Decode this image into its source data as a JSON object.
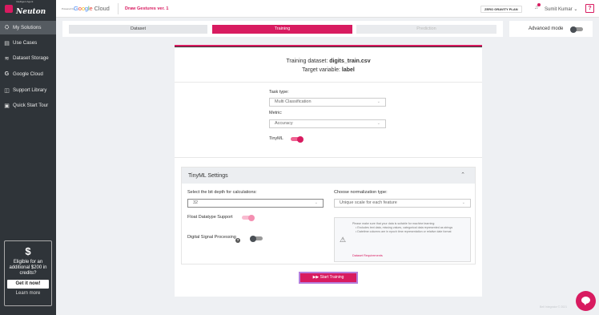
{
  "sidebar": {
    "logo_sub": "Intelligent Agent",
    "logo_name": "Neuton",
    "items": [
      {
        "label": "My Solutions",
        "icon": "gear-shield-icon",
        "active": true
      },
      {
        "label": "Use Cases",
        "icon": "briefcase-icon"
      },
      {
        "label": "Dataset Storage",
        "icon": "stack-icon"
      },
      {
        "label": "Google Cloud",
        "icon": "google-g-icon"
      },
      {
        "label": "Support Library",
        "icon": "book-icon"
      },
      {
        "label": "Quick Start Tour",
        "icon": "play-box-icon"
      }
    ],
    "credit": {
      "symbol": "$",
      "text": "Eligible for an additional $200 in credits?",
      "button": "Get it now!",
      "link": "Learn more"
    }
  },
  "topbar": {
    "powered_by": "Powered by",
    "cloud_name": "Google Cloud",
    "project": "Draw Gestures ver. 1",
    "plan": "ZERO GRAVITY PLAN",
    "user": "Sumit Kumar",
    "help": "?"
  },
  "steps": {
    "items": [
      "Dataset",
      "Training",
      "Prediction"
    ],
    "active": "Training"
  },
  "advanced_mode": {
    "label": "Advanced mode",
    "enabled": false
  },
  "training": {
    "dataset_label": "Training dataset:",
    "dataset_value": "digits_train.csv",
    "target_label": "Target variable:",
    "target_value": "label",
    "task_type_label": "Task type:",
    "task_type_value": "Multi Classification",
    "metric_label": "Metric:",
    "metric_value": "Accuracy",
    "tinyml_label": "TinyML",
    "tinyml_enabled": true
  },
  "tinyml_settings": {
    "title": "TinyML Settings",
    "bit_depth_label": "Select the bit depth for calculations:",
    "bit_depth_value": "32",
    "normalization_label": "Choose normalization type:",
    "normalization_value": "Unique scale for each feature",
    "float_label": "Float Datatype Support",
    "float_enabled": true,
    "dsp_label": "Digital Signal Processing",
    "dsp_enabled": false,
    "info_intro": "Please make sure that your data is suitable for machine learning:",
    "info_bullets": [
      "Excludes text data, missing values, categorical data represented as strings",
      "Datetime columns are in epoch time representation or relative date format"
    ],
    "info_link": "Dataset Requirements"
  },
  "start_button": "Start Training",
  "footer": "Bell Integrator © 2021",
  "colors": {
    "accent": "#d81b60",
    "sidebar": "#2f3439",
    "background": "#eef0f3"
  }
}
